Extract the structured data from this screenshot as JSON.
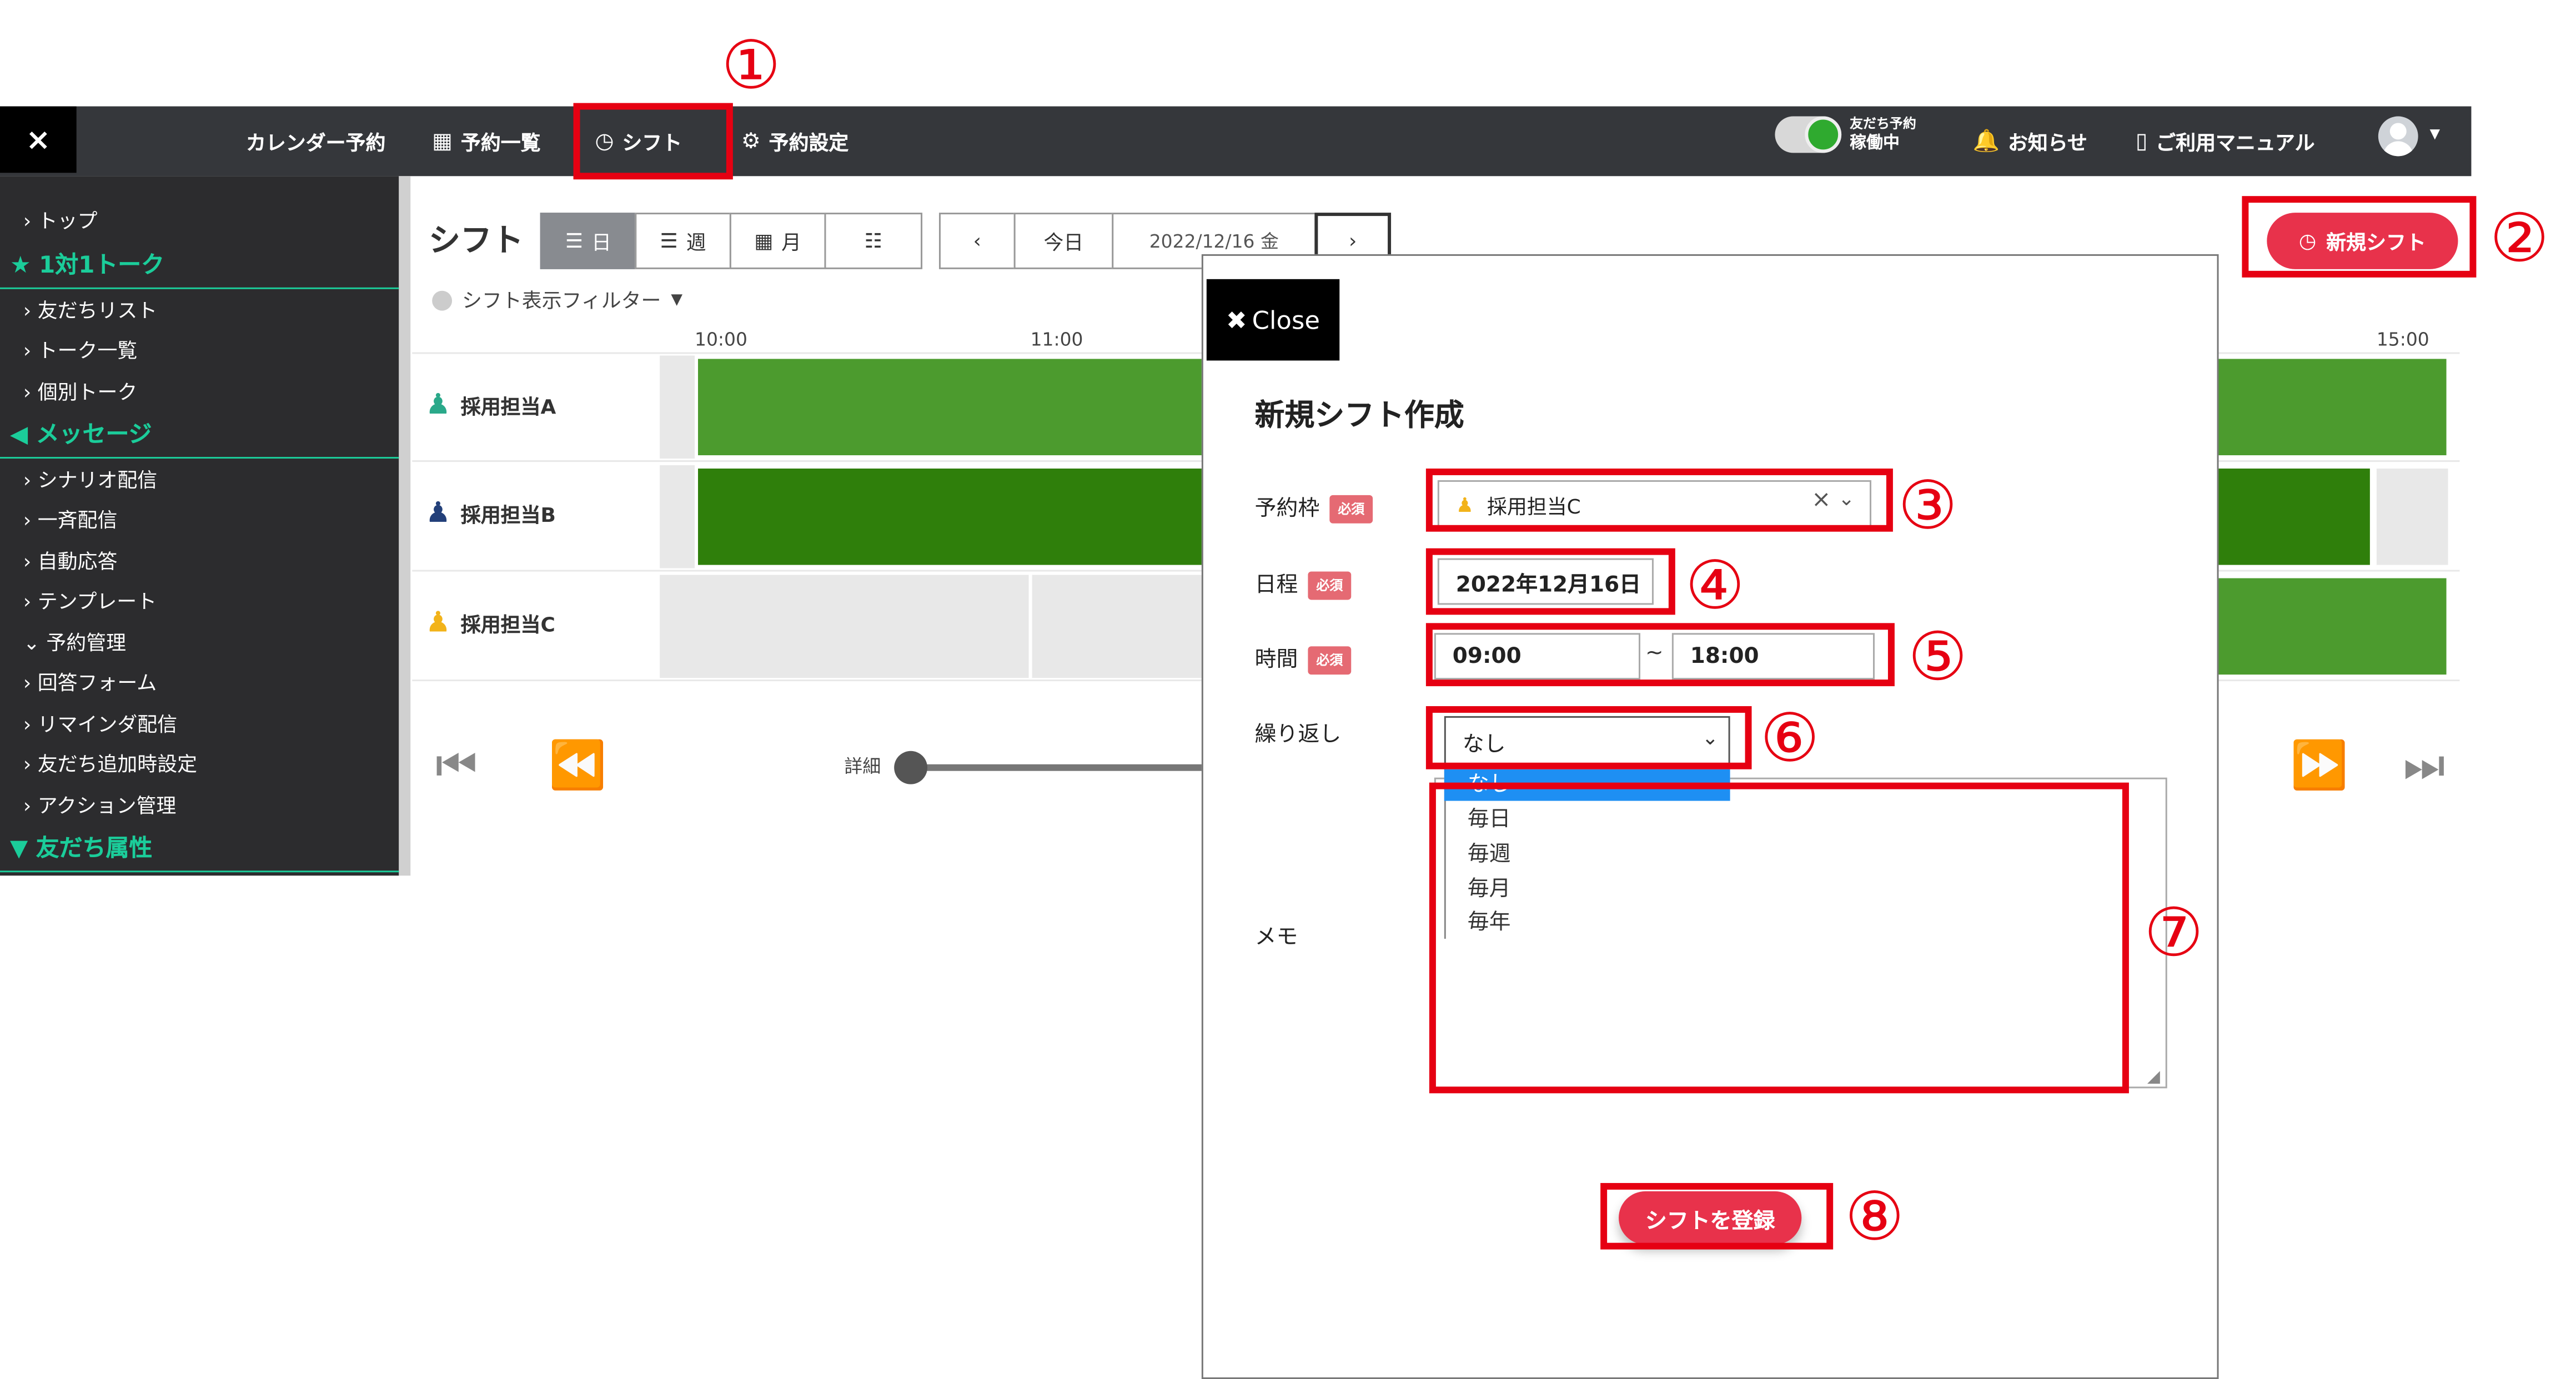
{
  "app": {
    "close_icon": "×"
  },
  "topnav": {
    "calendar": "カレンダー予約",
    "booking_list": "予約一覧",
    "shift": "シフト",
    "settings": "予約設定",
    "toggle_line1": "友だち予約",
    "toggle_line2": "稼働中",
    "news": "お知らせ",
    "manual": "ご利用マニュアル"
  },
  "sidebar": {
    "top": "トップ",
    "section_1on1": "1対1トーク",
    "friends": "友だちリスト",
    "talks": "トーク一覧",
    "individual": "個別トーク",
    "section_msg": "メッセージ",
    "scenario": "シナリオ配信",
    "broadcast": "一斉配信",
    "autoreply": "自動応答",
    "template": "テンプレート",
    "booking": "予約管理",
    "form": "回答フォーム",
    "reminder": "リマインダ配信",
    "addsetting": "友だち追加時設定",
    "action": "アクション管理",
    "section_attr": "友だち属性"
  },
  "main": {
    "title": "シフト",
    "view_day": "日",
    "view_week": "週",
    "view_month": "月",
    "today": "今日",
    "date": "2022/12/16 金",
    "filter": "シフト表示フィルター",
    "times": [
      "10:00",
      "11:00",
      "15:00"
    ],
    "rows": [
      "採用担当A",
      "採用担当B",
      "採用担当C"
    ],
    "detail": "詳細",
    "new_shift": "新規シフト"
  },
  "modal": {
    "close": "Close",
    "title": "新規シフト作成",
    "required": "必須",
    "label_slot": "予約枠",
    "slot_value": "採用担当C",
    "label_date": "日程",
    "date_value": "2022年12月16日",
    "label_time": "時間",
    "time_from": "09:00",
    "time_sep": "~",
    "time_to": "18:00",
    "label_repeat": "繰り返し",
    "repeat_value": "なし",
    "repeat_options": [
      "なし",
      "毎日",
      "毎週",
      "毎月",
      "毎年"
    ],
    "label_memo": "メモ",
    "submit": "シフトを登録"
  },
  "annotations": [
    "①",
    "②",
    "③",
    "④",
    "⑤",
    "⑥",
    "⑦",
    "⑧"
  ],
  "colors": {
    "topbar": "#35373b",
    "sidebar": "#2c2c2e",
    "accent": "#1bcd9a",
    "primary_button": "#e8324b",
    "shift_bar": "#4c9b2e",
    "annotation": "#e60012"
  }
}
